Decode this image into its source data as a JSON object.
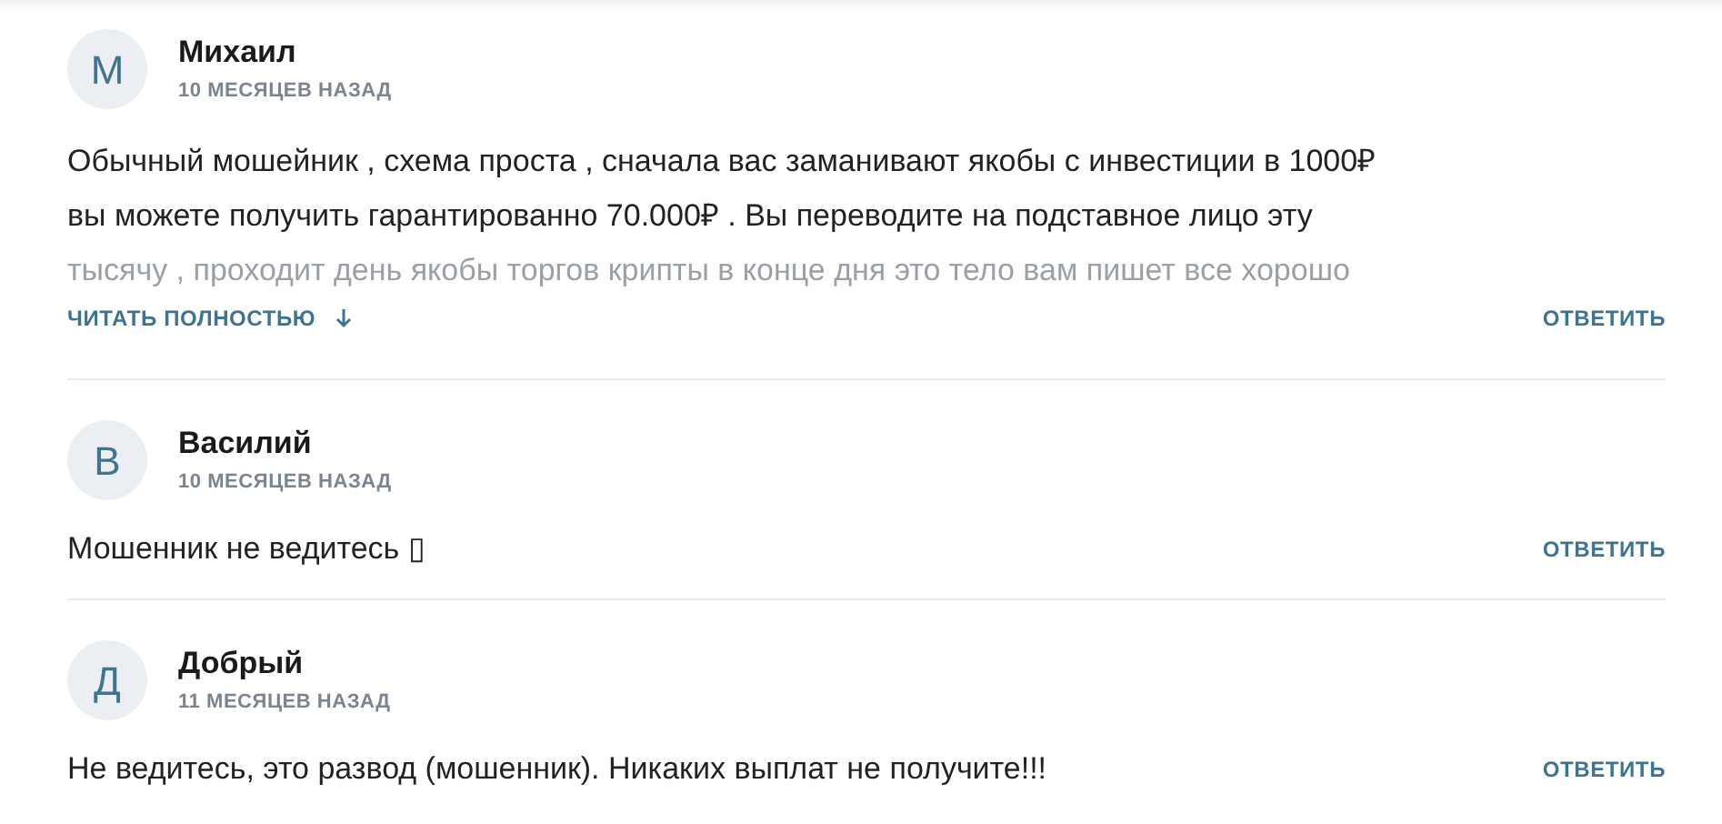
{
  "comments": [
    {
      "initial": "М",
      "author": "Михаил",
      "time": "10 МЕСЯЦЕВ НАЗАД",
      "collapsed": true,
      "text_lines": [
        "Обычный мошейник , схема проста , сначала вас заманивают якобы с инвестиции в 1000₽",
        "вы можете получить гарантированно 70.000₽ . Вы переводите на подставное лицо эту",
        "тысячу , проходит день якобы торгов крипты в конце дня это тело вам пишет все хорошо"
      ],
      "read_more": "ЧИТАТЬ ПОЛНОСТЬЮ",
      "reply": "ОТВЕТИТЬ"
    },
    {
      "initial": "В",
      "author": "Василий",
      "time": "10 МЕСЯЦЕВ НАЗАД",
      "collapsed": false,
      "text_lines": [
        "Мошенник не ведитесь ▯"
      ],
      "reply": "ОТВЕТИТЬ"
    },
    {
      "initial": "Д",
      "author": "Добрый",
      "time": "11 МЕСЯЦЕВ НАЗАД",
      "collapsed": false,
      "text_lines": [
        "Не ведитесь, это развод (мошенник). Никаких выплат не получите!!!"
      ],
      "reply": "ОТВЕТИТЬ"
    }
  ]
}
